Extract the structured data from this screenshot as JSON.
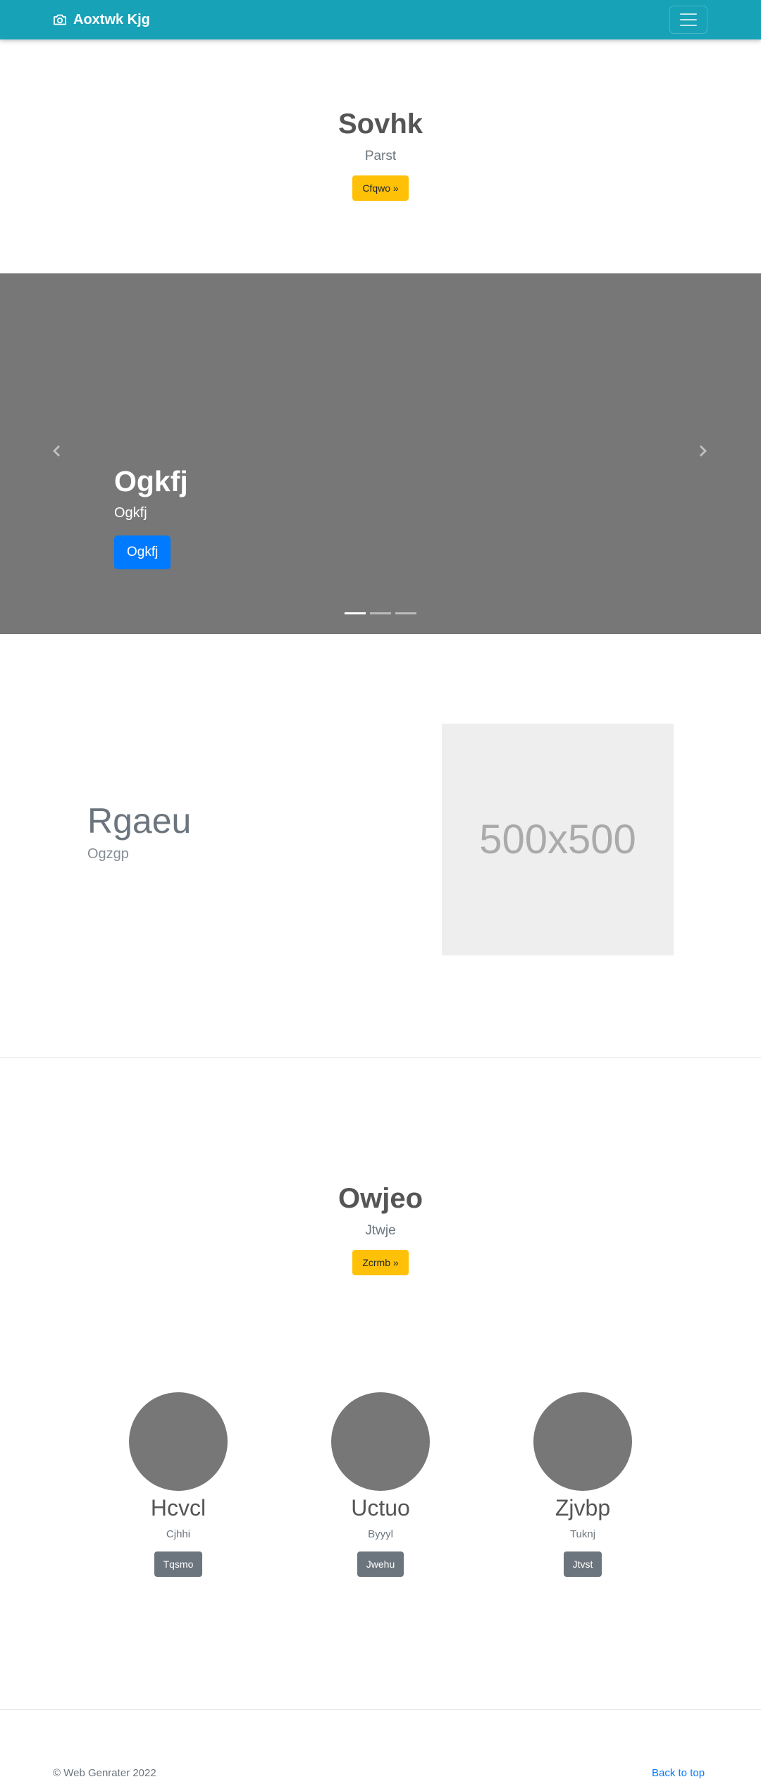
{
  "navbar": {
    "brand": "Aoxtwk Kjg",
    "brand_icon": "camera-icon",
    "toggler_icon": "hamburger-icon"
  },
  "hero": {
    "title": "Sovhk",
    "subtitle": "Parst",
    "button": "Cfqwo »"
  },
  "carousel": {
    "caption_title": "Ogkfj",
    "caption_text": "Ogkfj",
    "button": "Ogkfj",
    "slide_count": 3,
    "active_slide": 1
  },
  "feature": {
    "title": "Rgaeu",
    "subtitle": "Ogzgp",
    "image_placeholder": "500x500"
  },
  "hero2": {
    "title": "Owjeo",
    "subtitle": "Jtwje",
    "button": "Zcrmb »"
  },
  "team": [
    {
      "name": "Hcvcl",
      "role": "Cjhhi",
      "button": "Tqsmo"
    },
    {
      "name": "Uctuo",
      "role": "Byyyl",
      "button": "Jwehu"
    },
    {
      "name": "Zjvbp",
      "role": "Tuknj",
      "button": "Jtvst"
    }
  ],
  "footer": {
    "copyright": "© Web Genrater 2022",
    "back_to_top": "Back to top"
  },
  "colors": {
    "navbar": "#17a2b8",
    "warning": "#ffc107",
    "primary": "#007bff",
    "secondary": "#6c757d",
    "carousel_bg": "#777777"
  }
}
